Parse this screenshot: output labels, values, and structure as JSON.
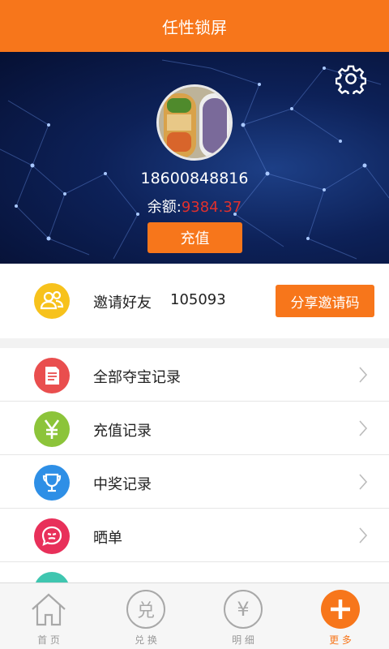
{
  "header": {
    "title": "任性锁屏"
  },
  "profile": {
    "phone": "18600848816",
    "balance_label": "余额:",
    "balance_value": "9384.37",
    "recharge_label": "充值"
  },
  "invite": {
    "label": "邀请好友",
    "code": "105093",
    "share_label": "分享邀请码"
  },
  "menu": {
    "items": [
      {
        "label": "全部夺宝记录",
        "icon": "document-icon",
        "color": "#e94e4e"
      },
      {
        "label": "充值记录",
        "icon": "yen-icon",
        "color": "#8cc43a"
      },
      {
        "label": "中奖记录",
        "icon": "trophy-icon",
        "color": "#2e8fe6"
      },
      {
        "label": "晒单",
        "icon": "chat-icon",
        "color": "#e8305a"
      },
      {
        "label": "",
        "icon": "partial-icon",
        "color": "#3fc6b0"
      }
    ]
  },
  "tabs": [
    {
      "label": "首 页",
      "icon": "home-icon"
    },
    {
      "label": "兑 换",
      "icon": "exchange-icon",
      "glyph": "兑"
    },
    {
      "label": "明 细",
      "icon": "yen-circle-icon",
      "glyph": "¥"
    },
    {
      "label": "更 多",
      "icon": "plus-icon",
      "active": true
    }
  ],
  "colors": {
    "accent": "#f7761b",
    "balance": "#e0302d"
  }
}
